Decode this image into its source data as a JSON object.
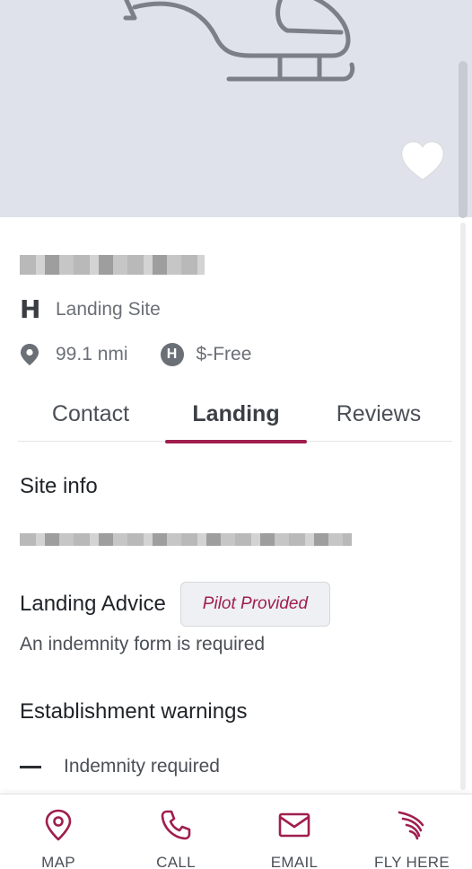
{
  "hero": {
    "image_icon": "helicopter-icon",
    "favorite_icon": "heart-icon"
  },
  "site": {
    "name": "",
    "type_icon": "h-icon",
    "type_label": "Landing Site",
    "distance": "99.1 nmi",
    "fee_icon": "helipad-icon",
    "fee": "$-Free",
    "fee_icon_text": "H"
  },
  "tabs": [
    {
      "label": "Contact"
    },
    {
      "label": "Landing"
    },
    {
      "label": "Reviews"
    }
  ],
  "active_tab": "Landing",
  "landing": {
    "site_info_title": "Site info",
    "landing_advice_title": "Landing Advice",
    "landing_advice_badge": "Pilot Provided",
    "landing_advice_text": "An indemnity form is required",
    "warnings_title": "Establishment warnings",
    "warnings": [
      "Indemnity required"
    ]
  },
  "nav": [
    {
      "label": "MAP",
      "icon": "map-pin-icon"
    },
    {
      "label": "CALL",
      "icon": "phone-icon"
    },
    {
      "label": "EMAIL",
      "icon": "mail-icon"
    },
    {
      "label": "FLY HERE",
      "icon": "wing-icon"
    }
  ],
  "colors": {
    "accent": "#a01e4e",
    "hero_bg": "#dfe2ea",
    "icon_grey": "#6b6f76"
  }
}
